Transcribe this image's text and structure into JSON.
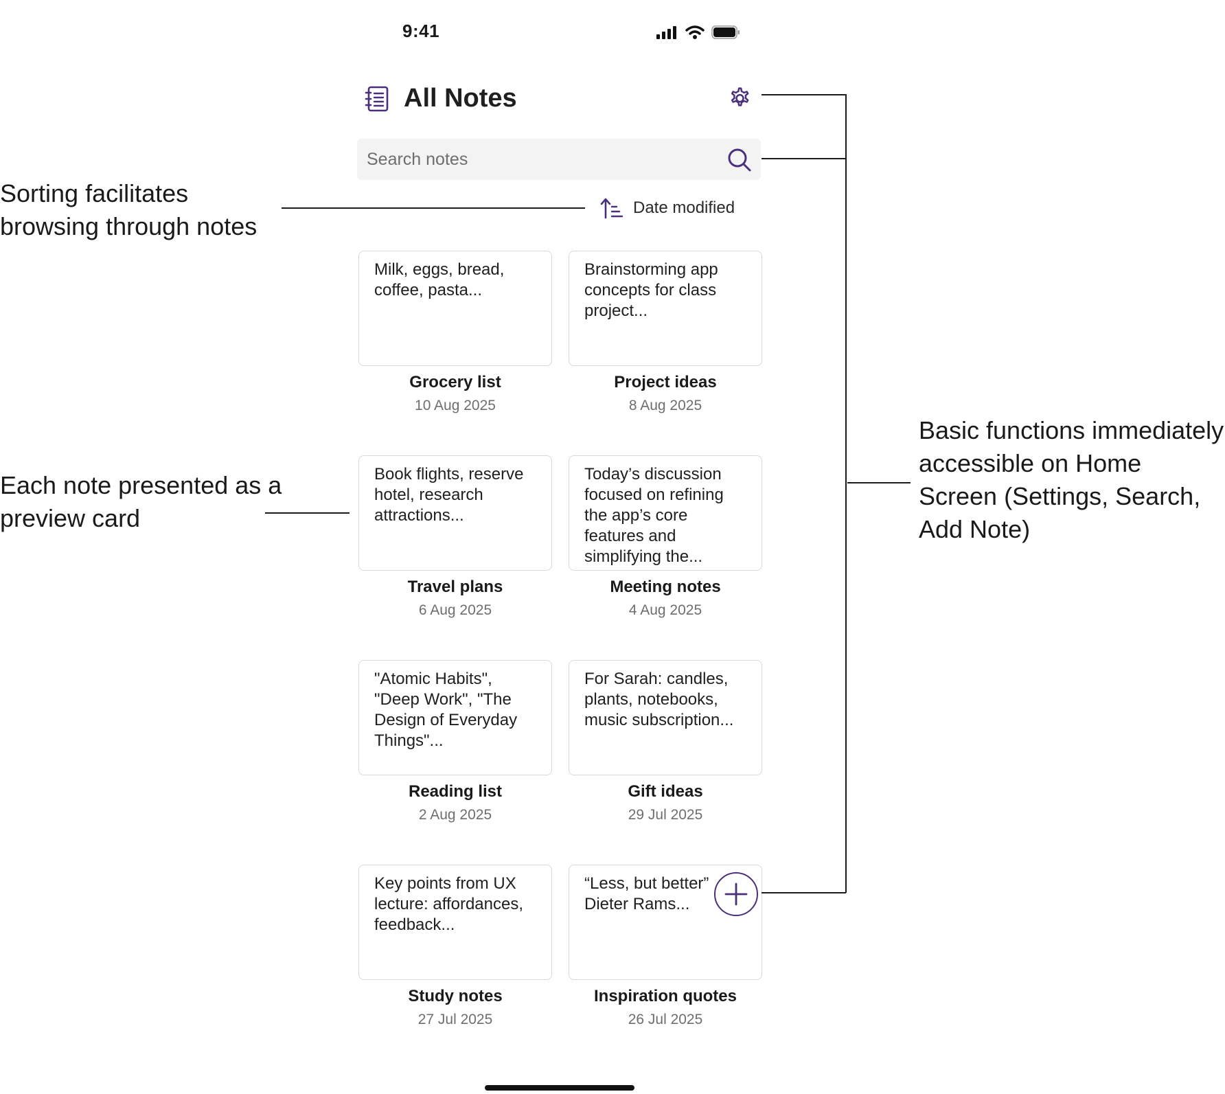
{
  "status_bar": {
    "time": "9:41"
  },
  "header": {
    "title": "All Notes",
    "app_icon": "notebook-icon",
    "settings_icon": "gear-icon"
  },
  "search": {
    "placeholder": "Search notes",
    "value": "",
    "icon": "search-icon"
  },
  "sort": {
    "label": "Date modified",
    "icon": "sort-ascending-icon"
  },
  "notes": [
    {
      "preview": "Milk, eggs, bread, coffee, pasta...",
      "title": "Grocery list",
      "date": "10 Aug 2025"
    },
    {
      "preview": "Brainstorming app concepts for class project...",
      "title": "Project ideas",
      "date": "8 Aug 2025"
    },
    {
      "preview": "Book flights, reserve hotel, research attractions...",
      "title": "Travel plans",
      "date": "6 Aug 2025"
    },
    {
      "preview": "Today’s discussion focused on refining the app’s core features and simplifying the...",
      "title": "Meeting notes",
      "date": "4 Aug 2025"
    },
    {
      "preview": "\"Atomic Habits\", \"Deep Work\", \"The Design of Everyday Things\"...",
      "title": "Reading list",
      "date": "2 Aug 2025"
    },
    {
      "preview": "For Sarah: candles, plants, notebooks, music subscription...",
      "title": "Gift ideas",
      "date": "29 Jul 2025"
    },
    {
      "preview": "Key points from UX lecture: affordances, feedback...",
      "title": "Study notes",
      "date": "27 Jul 2025"
    },
    {
      "preview": "“Less, but better” Dieter Rams...",
      "title": "Inspiration quotes",
      "date": "26 Jul 2025"
    }
  ],
  "add_button": {
    "icon": "plus-icon"
  },
  "annotations": {
    "sorting": "Sorting facilitates browsing through notes",
    "cards": "Each note presented as a preview card",
    "functions": "Basic functions immediately accessible on Home Screen (Settings, Search, Add Note)"
  },
  "colors": {
    "accent": "#4a2f7a",
    "card_border": "#d9d9d9",
    "search_bg": "#f3f3f3",
    "muted_text": "#6e6e6e"
  }
}
